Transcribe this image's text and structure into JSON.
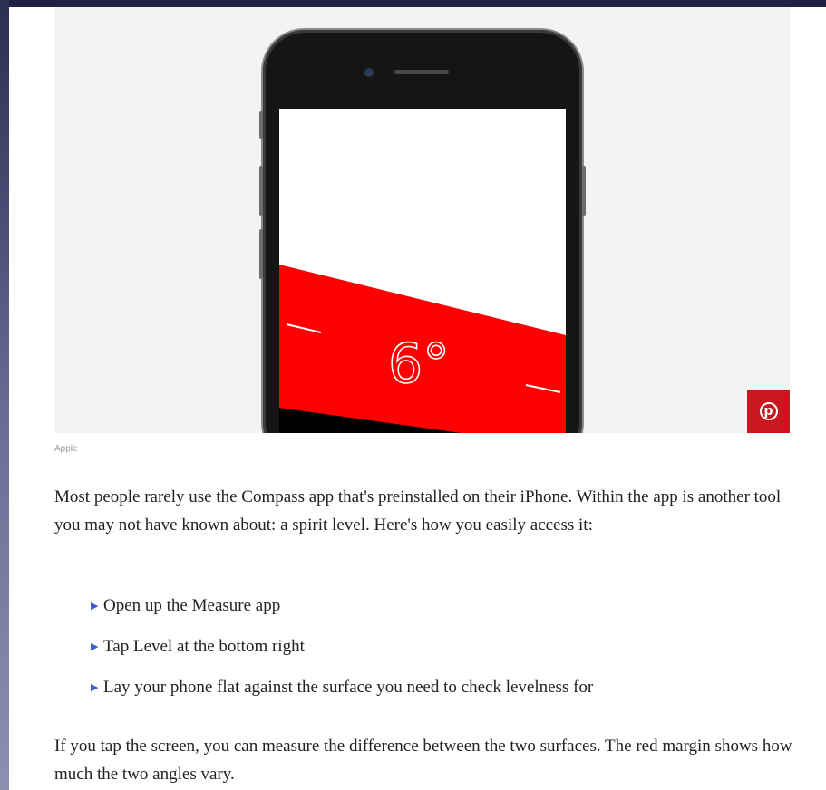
{
  "article": {
    "image_caption": "Apple",
    "level_reading": "6°",
    "intro_paragraph": "Most people rarely use the Compass app that's preinstalled on their iPhone. Within the app is another tool you may not have known about: a spirit level. Here's how you easily access it:",
    "steps": [
      "Open up the Measure app",
      "Tap Level at the bottom right",
      "Lay your phone flat against the surface you need to check levelness for"
    ],
    "closing_paragraph": "If you tap the screen, you can measure the difference between the two surfaces. The red margin shows how much the two angles vary."
  },
  "pinterest": {
    "icon": "pinterest-icon",
    "glyph": "p"
  },
  "colors": {
    "level_red": "#ff0000",
    "pin_red": "#c8171e",
    "bullet_blue": "#3b5bd8"
  }
}
